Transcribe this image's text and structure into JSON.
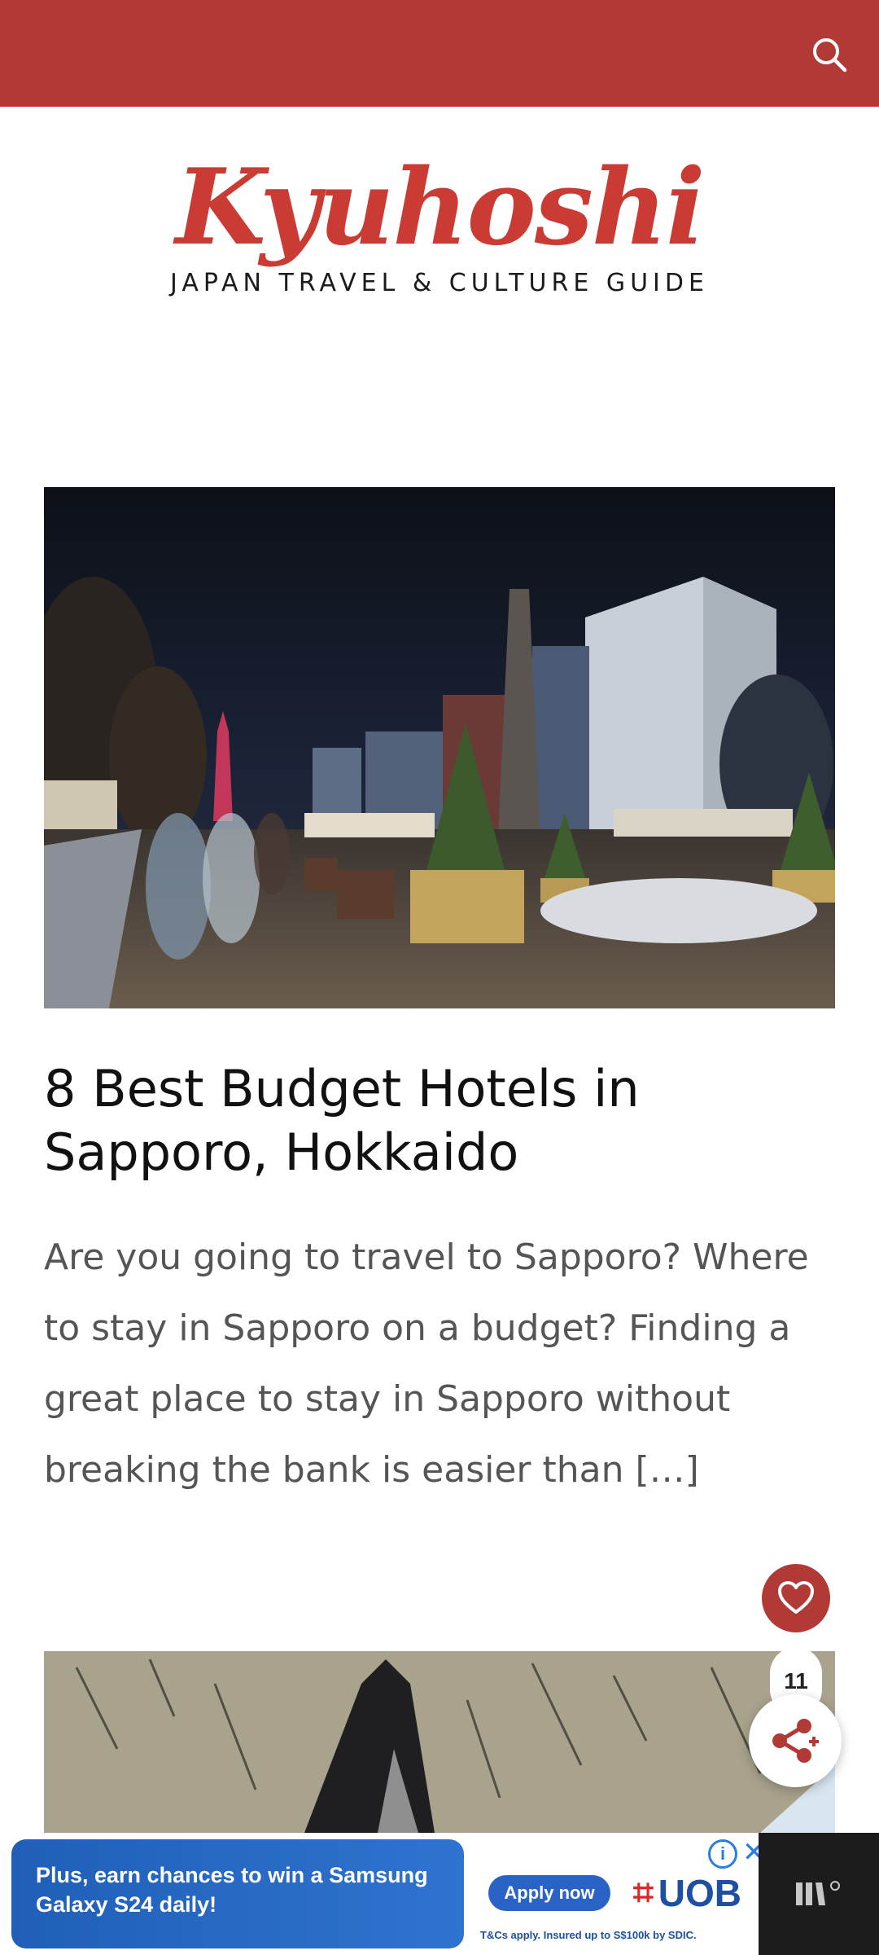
{
  "header": {
    "bg_color": "#b23a36",
    "search_icon": "search-icon"
  },
  "brand": {
    "logo": "Kyuhoshi",
    "tagline": "JAPAN TRAVEL & CULTURE GUIDE",
    "logo_color": "#c93b33"
  },
  "post": {
    "title": "8 Best Budget Hotels in Sapporo, Hokkaido",
    "excerpt": "Are you going to travel to Sapporo? Where to stay in Sapporo on a budget? Finding a great place to stay in Sapporo without breaking the bank is easier than […]"
  },
  "floating": {
    "favorite_icon": "heart-icon",
    "share_count": "11",
    "share_icon": "share-icon"
  },
  "ad": {
    "promo_text": "Plus, earn chances to win a Samsung Galaxy S24 daily!",
    "cta": "Apply now",
    "brand": "UOB",
    "disclaimer": "T&Cs apply. Insured up to S$100k by SDIC.",
    "info_icon": "info-icon",
    "close_icon": "close-icon",
    "network_logo_icon": "ad-network-logo-icon"
  }
}
